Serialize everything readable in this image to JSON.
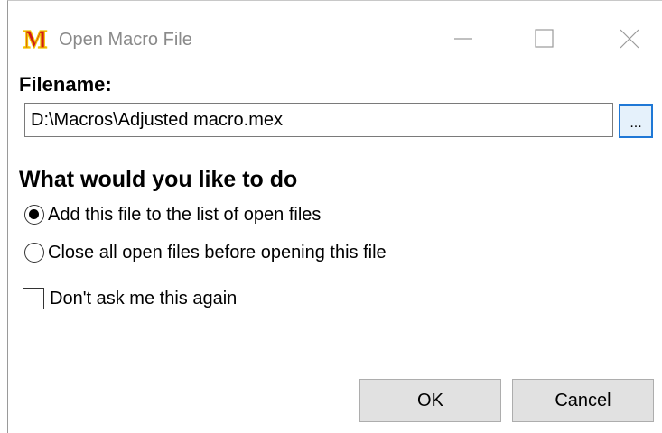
{
  "window": {
    "title": "Open Macro File",
    "icon": "macro-m-icon",
    "controls": [
      "minimize-icon",
      "maximize-icon",
      "close-icon"
    ]
  },
  "filename": {
    "label": "Filename:",
    "value": "D:\\Macros\\Adjusted macro.mex",
    "browse_label": "..."
  },
  "options": {
    "heading": "What would you like to do",
    "radios": [
      {
        "label": "Add this file to the list of open files",
        "checked": true
      },
      {
        "label": "Close all open files before opening this file",
        "checked": false
      }
    ]
  },
  "dont_ask": {
    "label": "Don't ask me this again",
    "checked": false
  },
  "buttons": {
    "ok": "OK",
    "cancel": "Cancel"
  },
  "colors": {
    "icon_red": "#d01a1a",
    "icon_yellow": "#f2c200",
    "focus_blue": "#1f78d6"
  }
}
